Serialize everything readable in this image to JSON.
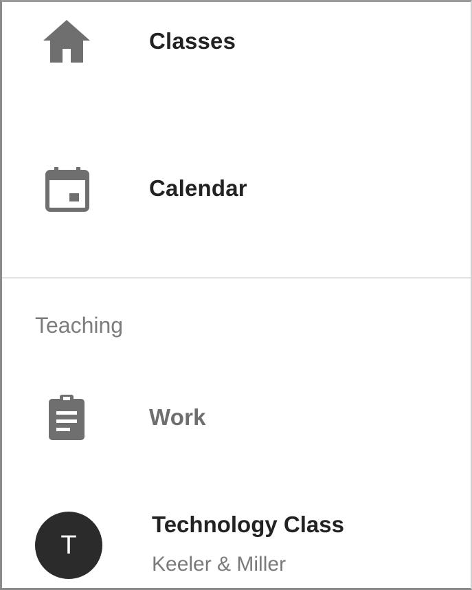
{
  "nav": {
    "items": [
      {
        "label": "Classes",
        "icon": "home-icon"
      },
      {
        "label": "Calendar",
        "icon": "calendar-icon"
      }
    ]
  },
  "teaching": {
    "header": "Teaching",
    "work": {
      "label": "Work",
      "icon": "assignment-icon"
    },
    "class": {
      "avatar_letter": "T",
      "name": "Technology Class",
      "subtitle": "Keeler & Miller"
    }
  },
  "colors": {
    "icon_gray": "#6f6f6f",
    "text_dark": "#222222",
    "text_muted": "#7a7a7a",
    "avatar_bg": "#2b2b2b",
    "divider": "#e2e2e2"
  }
}
